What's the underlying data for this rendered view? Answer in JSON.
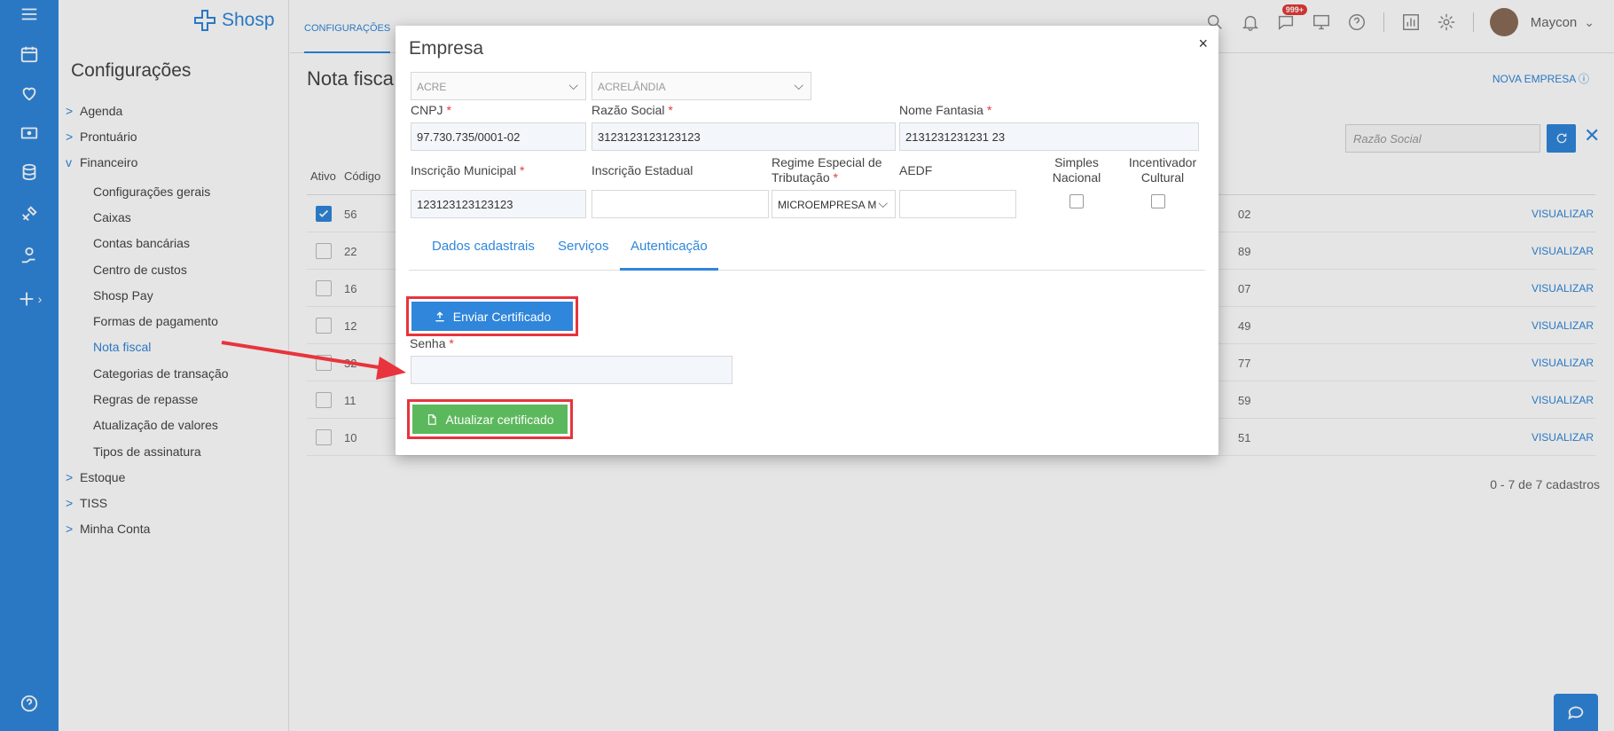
{
  "rail": {
    "icons": [
      "hamburger-menu-icon",
      "calendar-icon",
      "heart-icon",
      "cash-icon",
      "database-icon",
      "tools-icon",
      "hand-coin-icon",
      "plus-icon",
      "help-icon"
    ]
  },
  "logo": {
    "text": "Shosp"
  },
  "sidebar": {
    "title": "Configurações",
    "items": [
      {
        "label": "Agenda",
        "chevron": ">"
      },
      {
        "label": "Prontuário",
        "chevron": ">"
      },
      {
        "label": "Financeiro",
        "chevron": "v"
      }
    ],
    "financeiro_subitems": [
      "Configurações gerais",
      "Caixas",
      "Contas bancárias",
      "Centro de custos",
      "Shosp Pay",
      "Formas de pagamento",
      "Nota fiscal",
      "Categorias de transação",
      "Regras de repasse",
      "Atualização de valores",
      "Tipos de assinatura"
    ],
    "items_after": [
      {
        "label": "Estoque",
        "chevron": ">"
      },
      {
        "label": "TISS",
        "chevron": ">"
      },
      {
        "label": "Minha Conta",
        "chevron": ">"
      }
    ]
  },
  "topbar": {
    "tab_label": "CONFIGURAÇÕES",
    "badge": "999+",
    "user_name": "Maycon",
    "user_chevron": "⌄"
  },
  "page": {
    "title": "Nota fisca",
    "nova_empresa": "NOVA EMPRESA ⓘ",
    "search_placeholder": "Razão Social",
    "clear_symbol": "✕",
    "col_ativo": "Ativo",
    "col_codigo": "Código",
    "rows": [
      {
        "checked": true,
        "code": "56",
        "tail": "02",
        "action": "VISUALIZAR"
      },
      {
        "checked": false,
        "code": "22",
        "tail": "89",
        "action": "VISUALIZAR"
      },
      {
        "checked": false,
        "code": "16",
        "tail": "07",
        "action": "VISUALIZAR"
      },
      {
        "checked": false,
        "code": "12",
        "tail": "49",
        "action": "VISUALIZAR"
      },
      {
        "checked": false,
        "code": "32",
        "tail": "77",
        "action": "VISUALIZAR"
      },
      {
        "checked": false,
        "code": "11",
        "tail": "59",
        "action": "VISUALIZAR"
      },
      {
        "checked": false,
        "code": "10",
        "tail": "51",
        "action": "VISUALIZAR"
      }
    ],
    "count_text": "0 - 7 de 7 cadastros"
  },
  "modal": {
    "title": "Empresa",
    "close": "×",
    "estado": "ACRE",
    "cidade": "ACRELÂNDIA",
    "cnpj_label": "CNPJ",
    "cnpj_value": "97.730.735/0001-02",
    "razao_label": "Razão Social",
    "razao_value": "3123123123123123",
    "fantasia_label": "Nome Fantasia",
    "fantasia_value": "2131231231231 23",
    "im_label": "Inscrição Municipal",
    "im_value": "123123123123123",
    "ie_label": "Inscrição Estadual",
    "ie_value": "",
    "regime_label_1": "Regime Especial de",
    "regime_label_2": "Tributação",
    "regime_value": "MICROEMPRESA M",
    "aedf_label": "AEDF",
    "aedf_value": "",
    "simples_label_1": "Simples",
    "simples_label_2": "Nacional",
    "incentivador_label_1": "Incentivador",
    "incentivador_label_2": "Cultural",
    "required_mark": "*",
    "tabs": [
      "Dados cadastrais",
      "Serviços",
      "Autenticação"
    ],
    "enviar_label": "Enviar Certificado",
    "senha_label": "Senha",
    "senha_value": "",
    "atualizar_label": "Atualizar certificado"
  },
  "colors": {
    "primary": "#2f86db",
    "success": "#5cb85c",
    "highlight": "#e8343c",
    "required": "#e53935"
  }
}
